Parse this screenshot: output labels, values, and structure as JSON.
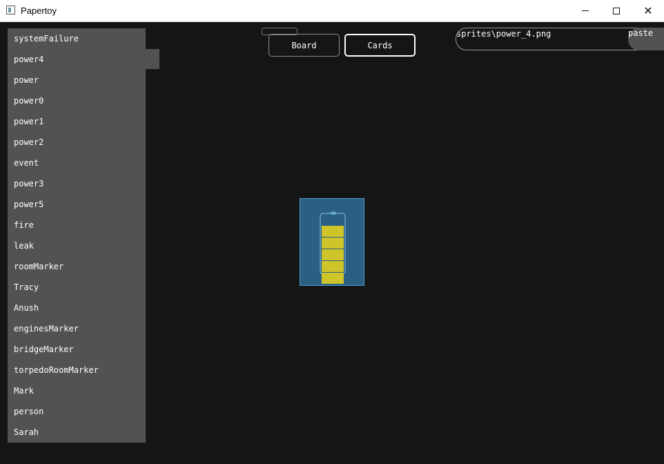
{
  "window": {
    "title": "Papertoy"
  },
  "sidebar": {
    "items": [
      {
        "label": "systemFailure"
      },
      {
        "label": "power4"
      },
      {
        "label": "power"
      },
      {
        "label": "power0"
      },
      {
        "label": "power1"
      },
      {
        "label": "power2"
      },
      {
        "label": "event"
      },
      {
        "label": "power3"
      },
      {
        "label": "power5"
      },
      {
        "label": "fire"
      },
      {
        "label": "leak"
      },
      {
        "label": "roomMarker"
      },
      {
        "label": "Tracy"
      },
      {
        "label": "Anush"
      },
      {
        "label": "enginesMarker"
      },
      {
        "label": "bridgeMarker"
      },
      {
        "label": "torpedoRoomMarker"
      },
      {
        "label": "Mark"
      },
      {
        "label": "person"
      },
      {
        "label": "Sarah"
      }
    ]
  },
  "tabs": {
    "board": "Board",
    "cards": "Cards",
    "active": "Cards"
  },
  "sprite_path": {
    "value": "sprites\\power_4.png",
    "paste_label": "paste"
  },
  "preview": {
    "icon": "battery-icon",
    "battery_bars_filled": 5,
    "battery_bars_total": 5
  },
  "colors": {
    "background": "#151515",
    "sidebar": "#525252",
    "card_fill": "#2b5f84",
    "card_border": "#4e9fd6",
    "battery_fill": "#cfc52a"
  }
}
